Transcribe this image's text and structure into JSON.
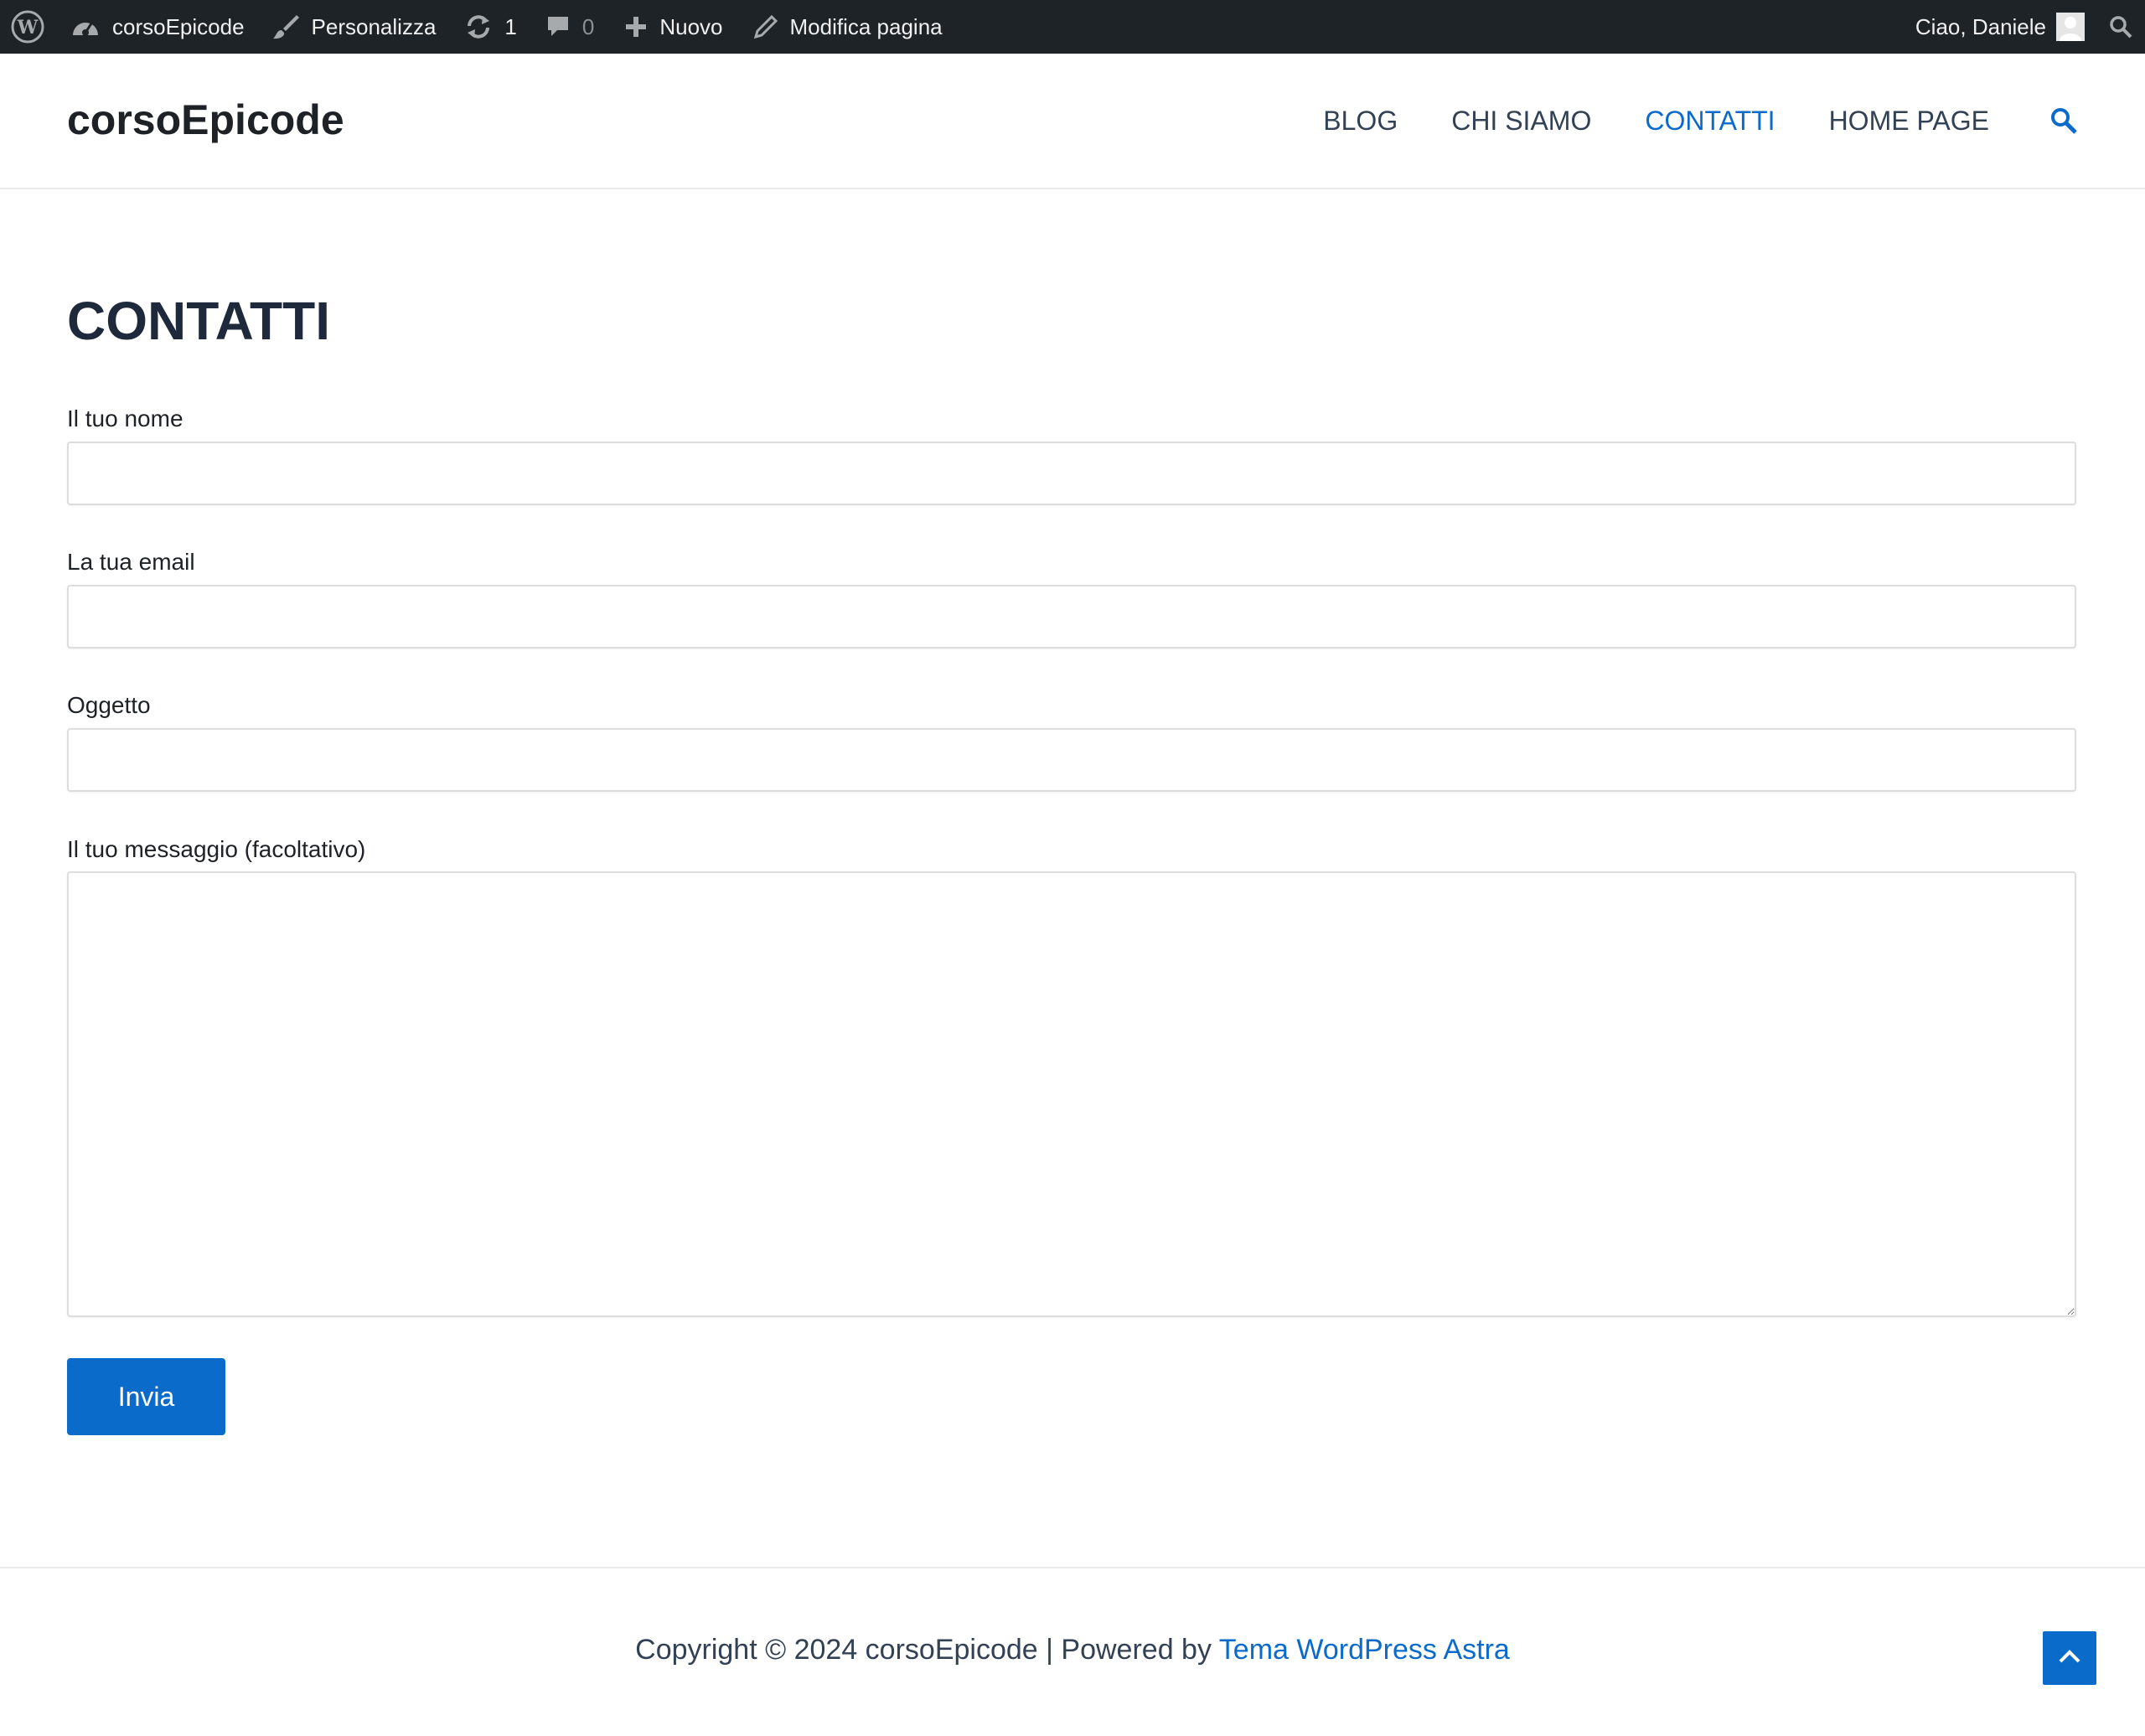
{
  "adminbar": {
    "site_name": "corsoEpicode",
    "customize": "Personalizza",
    "updates_count": "1",
    "comments_count": "0",
    "new": "Nuovo",
    "edit_page": "Modifica pagina",
    "greeting": "Ciao, Daniele"
  },
  "header": {
    "site_title": "corsoEpicode",
    "nav": {
      "blog": "BLOG",
      "about": "CHI SIAMO",
      "contacts": "CONTATTI",
      "home": "HOME PAGE"
    }
  },
  "main": {
    "title": "CONTATTI",
    "form": {
      "name_label": "Il tuo nome",
      "email_label": "La tua email",
      "subject_label": "Oggetto",
      "message_label": "Il tuo messaggio (facoltativo)",
      "submit_label": "Invia"
    }
  },
  "footer": {
    "copyright": "Copyright © 2024 corsoEpicode | Powered by ",
    "theme_link": "Tema WordPress Astra"
  },
  "colors": {
    "accent": "#0b6bcb",
    "adminbar_bg": "#1d2327",
    "heading": "#1e293b"
  }
}
